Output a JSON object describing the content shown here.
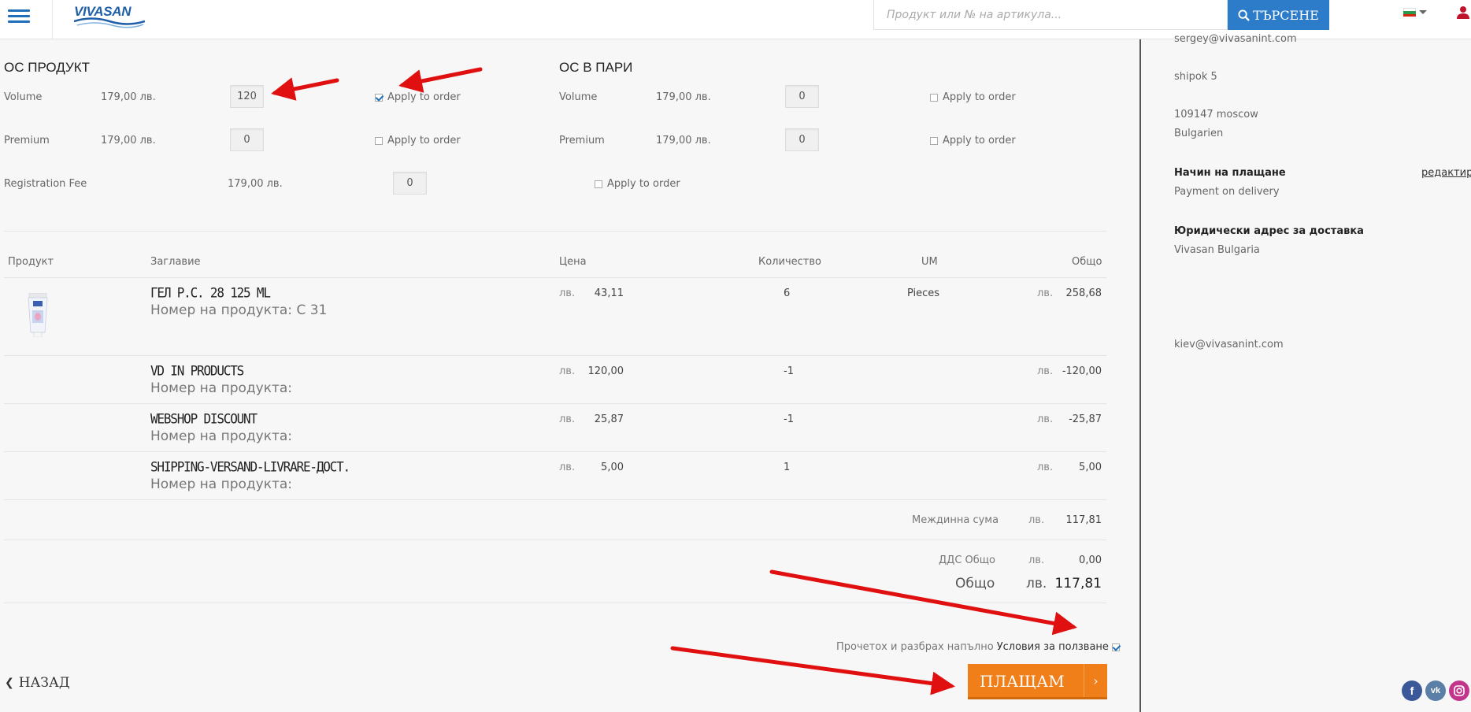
{
  "header": {
    "logo_text": "VIVASAN",
    "search_placeholder": "Продукт или № на артикула...",
    "search_button": "ТЪРСЕНЕ"
  },
  "bonus": {
    "product_title": "ОС ПРОДУКТ",
    "money_title": "ОС В ПАРИ",
    "apply_label": "Apply to order",
    "product_rows": [
      {
        "label": "Volume",
        "amount": "179,00 лв.",
        "qty": "120",
        "apply_checked": true
      },
      {
        "label": "Premium",
        "amount": "179,00 лв.",
        "qty": "0",
        "apply_checked": false
      },
      {
        "label": "Registration Fee",
        "amount": "179,00 лв.",
        "qty": "0",
        "apply_checked": false
      }
    ],
    "money_rows": [
      {
        "label": "Volume",
        "amount": "179,00 лв.",
        "qty": "0",
        "apply_checked": false
      },
      {
        "label": "Premium",
        "amount": "179,00 лв.",
        "qty": "0",
        "apply_checked": false
      }
    ]
  },
  "table": {
    "headers": [
      "Продукт",
      "Заглавие",
      "Цена",
      "Количество",
      "UM",
      "Общо"
    ],
    "currency": "лв.",
    "rows": [
      {
        "name": "ГЕЛ P.C. 28 125 ML",
        "number": "Номер на продукта: C 31",
        "price": "43,11",
        "qty": "6",
        "um": "Pieces",
        "total": "258,68"
      },
      {
        "name": "VD IN PRODUCTS",
        "number": "Номер на продукта:",
        "price": "120,00",
        "qty": "-1",
        "um": "",
        "total": "-120,00"
      },
      {
        "name": "WEBSHOP DISCOUNT",
        "number": "Номер на продукта:",
        "price": "25,87",
        "qty": "-1",
        "um": "",
        "total": "-25,87"
      },
      {
        "name": "SHIPPING-VERSAND-LIVRARE-ДОСТ.",
        "number": "Номер на продукта:",
        "price": "5,00",
        "qty": "1",
        "um": "",
        "total": "5,00"
      }
    ]
  },
  "totals": {
    "subtotal_label": "Междинна сума",
    "subtotal": "117,81",
    "vat_label": "ДДС Общо",
    "vat": "0,00",
    "total_label": "Общо",
    "total": "117,81"
  },
  "terms": {
    "text": "Прочетох и разбрах напълно",
    "link": "Условия за ползване",
    "checked": true
  },
  "actions": {
    "back": "НАЗАД",
    "pay": "ПЛАЩАМ"
  },
  "sidebar": {
    "email_top": "sergey@vivasanint.com",
    "street": "shipok 5",
    "city": "109147 moscow",
    "country": "Bulgarien",
    "payment_title": "Начин на плащане",
    "edit_link": "редактира",
    "payment_method": "Payment on delivery",
    "legal_title": "Юридически адрес за доставка",
    "legal_name": "Vivasan Bulgaria",
    "email_bottom": "kiev@vivasanint.com"
  },
  "colors": {
    "brand_blue": "#2c7cc9",
    "pay_orange": "#f07f1a",
    "arrow_red": "#e01010"
  }
}
